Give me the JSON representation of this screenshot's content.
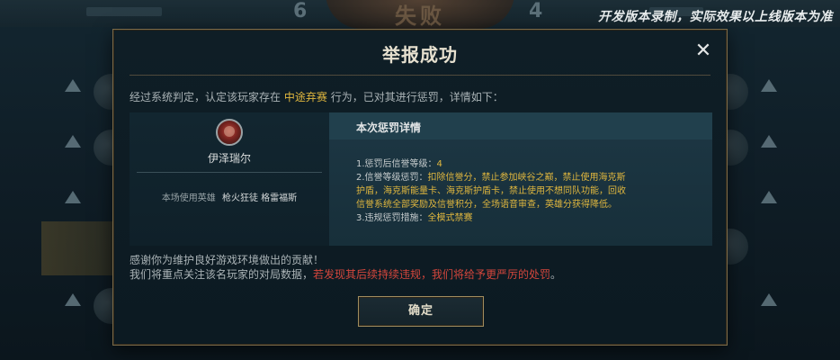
{
  "watermark": "开发版本录制，实际效果以上线版本为准",
  "background": {
    "banner_text": "失败",
    "score_left": "6",
    "score_right": "4"
  },
  "dialog": {
    "title": "举报成功",
    "close_icon": "close-icon",
    "intro_prefix": "经过系统判定，认定该玩家存在",
    "intro_highlight": "中途弃赛",
    "intro_suffix": "行为，已对其进行惩罚，详情如下：",
    "player": {
      "name": "伊泽瑞尔",
      "hero_label": "本场使用英雄",
      "heroes": "枪火狂徒 格雷福斯"
    },
    "penalty": {
      "title": "本次惩罚详情",
      "line1_label": "1.惩罚后信誉等级：",
      "line1_value": "4",
      "line2_label": "2.信誉等级惩罚：",
      "line2_value": "扣除信誉分，禁止参加峡谷之巅，禁止使用海克斯护盾，海克斯能量卡、海克斯护盾卡，禁止使用不想同队功能，回收信誉系统全部奖励及信誉积分，全场语音审查，英雄分获得降低。",
      "line3_label": "3.违规惩罚措施：",
      "line3_value": "全模式禁赛"
    },
    "thanks_line1": "感谢你为维护良好游戏环境做出的贡献！",
    "thanks_line2_prefix": "我们将重点关注该名玩家的对局数据，",
    "thanks_line2_warning": "若发现其后续持续违规，我们将给予更严厉的处罚",
    "thanks_line2_end": "。",
    "confirm_label": "确定"
  },
  "colors": {
    "highlight": "#e0b73e",
    "warning": "#d2463c",
    "border_gold": "#a08d5f"
  }
}
